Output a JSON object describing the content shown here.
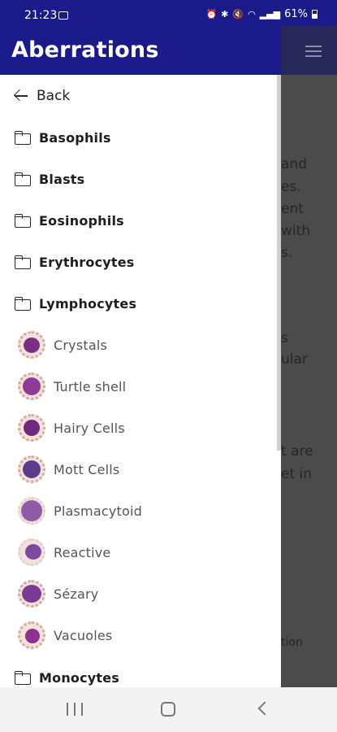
{
  "status_bar": {
    "time": "21:23",
    "battery": "61%",
    "icons": [
      "photo-icon",
      "alarm-icon",
      "bluetooth-icon",
      "mute-icon",
      "wifi-icon",
      "signal-icon",
      "battery-icon"
    ]
  },
  "header": {
    "title": "Aberrations",
    "background": "#1b1a8a"
  },
  "underlay": {
    "fragments": [
      "and",
      "es.",
      "ent",
      "with",
      "s.",
      "s",
      "ular",
      "t are",
      "et in",
      "tion"
    ]
  },
  "drawer": {
    "back_label": "Back",
    "categories_top": [
      "Basophils",
      "Blasts",
      "Eosinophils",
      "Erythrocytes",
      "Lymphocytes"
    ],
    "lymphocyte_items": [
      {
        "label": "Crystals",
        "icon": "crystals-cell-thumbnail"
      },
      {
        "label": "Turtle shell",
        "icon": "turtle-shell-cell-thumbnail"
      },
      {
        "label": "Hairy Cells",
        "icon": "hairy-cells-thumbnail"
      },
      {
        "label": "Mott Cells",
        "icon": "mott-cells-thumbnail"
      },
      {
        "label": "Plasmacytoid",
        "icon": "plasmacytoid-cell-thumbnail"
      },
      {
        "label": "Reactive",
        "icon": "reactive-cell-thumbnail"
      },
      {
        "label": "Sézary",
        "icon": "sezary-cell-thumbnail"
      },
      {
        "label": "Vacuoles",
        "icon": "vacuoles-cell-thumbnail"
      }
    ],
    "categories_bottom": [
      "Monocytes"
    ]
  },
  "nav_bar": {
    "icons": [
      "recent-apps-icon",
      "home-icon",
      "back-icon"
    ]
  }
}
